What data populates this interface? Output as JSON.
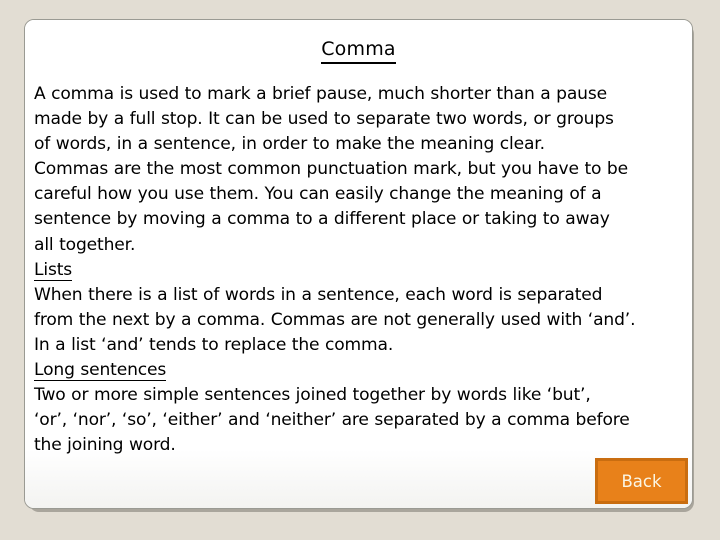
{
  "slide": {
    "title": "Comma",
    "background_color": "#e2ddd3",
    "card_color": "#ffffff",
    "card_border_color": "#9a9a93"
  },
  "body": {
    "lines": [
      {
        "text": "A comma is used to mark a brief pause, much shorter than a pause",
        "style": "normal"
      },
      {
        "text": "made by a full stop. It can be used to separate two words, or groups",
        "style": "normal"
      },
      {
        "text": "of words, in a sentence, in order to make the meaning clear.",
        "style": "normal"
      },
      {
        "text": "Commas are the most common punctuation mark, but you have to be",
        "style": "normal"
      },
      {
        "text": "careful how you use them. You can easily change the meaning of a",
        "style": "normal"
      },
      {
        "text": "sentence by moving a comma to a different place or taking to away",
        "style": "normal"
      },
      {
        "text": "all together.",
        "style": "normal"
      },
      {
        "text": "Lists",
        "style": "underline"
      },
      {
        "text": "When there is a list of words in a sentence, each word is separated",
        "style": "normal"
      },
      {
        "text": "from the next by a comma. Commas are not generally used with ‘and’.",
        "style": "normal"
      },
      {
        "text": "In a list ‘and’ tends to replace the comma.",
        "style": "normal"
      },
      {
        "text": "Long sentences",
        "style": "underline"
      },
      {
        "text": "Two or more simple sentences joined together by words like ‘but’,",
        "style": "normal"
      },
      {
        "text": "‘or’, ‘nor’, ‘so’, ‘either’ and ‘neither’ are separated by a comma before",
        "style": "normal"
      },
      {
        "text": "the joining word.",
        "style": "normal"
      }
    ]
  },
  "navigation": {
    "back_label": "Back",
    "back_fill_color": "#e8811a",
    "back_border_color": "#c96d10",
    "back_text_color": "#fbf6e4"
  }
}
